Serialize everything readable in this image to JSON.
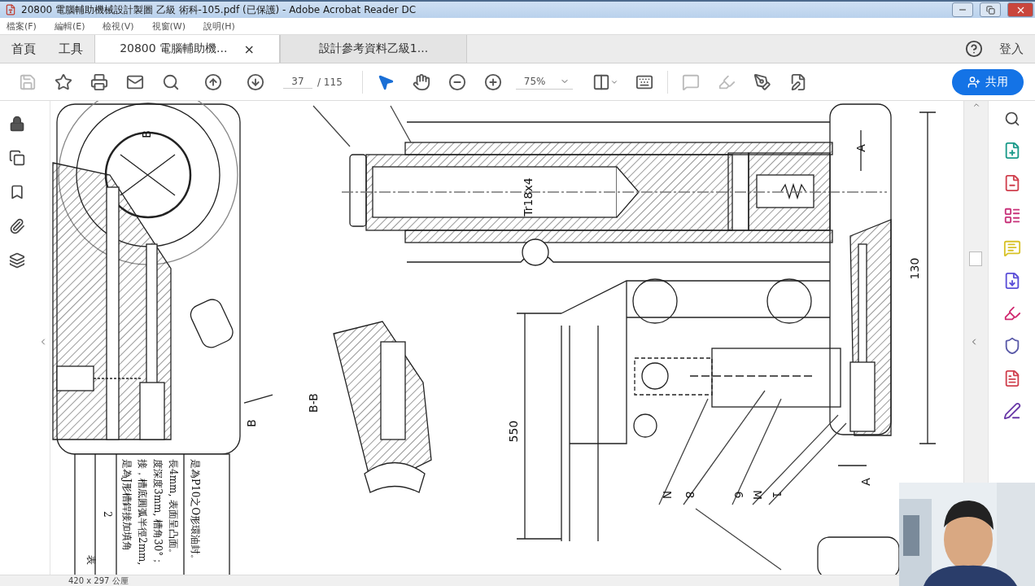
{
  "window": {
    "title": "20800 電腦輔助機械設計製圖 乙級 術科-105.pdf (已保護) - Adobe Acrobat Reader DC"
  },
  "menu": [
    "檔案(F)",
    "編輯(E)",
    "檢視(V)",
    "視窗(W)",
    "說明(H)"
  ],
  "nav_tabs": [
    {
      "label": "首頁",
      "selected": false
    },
    {
      "label": "工具",
      "selected": false
    }
  ],
  "doc_tabs": [
    {
      "label": "20800 電腦輔助機...",
      "selected": true,
      "close": "×"
    },
    {
      "label": "設計參考資料乙級1...",
      "selected": false
    }
  ],
  "sign_in": "登入",
  "toolbar": {
    "page_current": "37",
    "page_total": "/ 115",
    "zoom": "75%",
    "share": "共用"
  },
  "drawing": {
    "labels": [
      "B",
      "B",
      "B-B",
      "Tr18x4",
      "550",
      "130",
      "A",
      "A",
      "N",
      "8",
      "6",
      "M",
      "1"
    ]
  },
  "table": {
    "cells": [
      {
        "lines": [
          "表"
        ]
      },
      {
        "lines": [
          "2"
        ]
      },
      {
        "lines": [
          "是為J形槽銲接加填角",
          "接，槽底圓弧半徑2mm,",
          "度深度3mm, 槽角30°；",
          "長4mm, 表面呈凸面。"
        ]
      },
      {
        "lines": [
          "是為P10之O形環油封。"
        ]
      }
    ]
  },
  "status_bar": {
    "page_size": "420 x 297 公厘"
  }
}
